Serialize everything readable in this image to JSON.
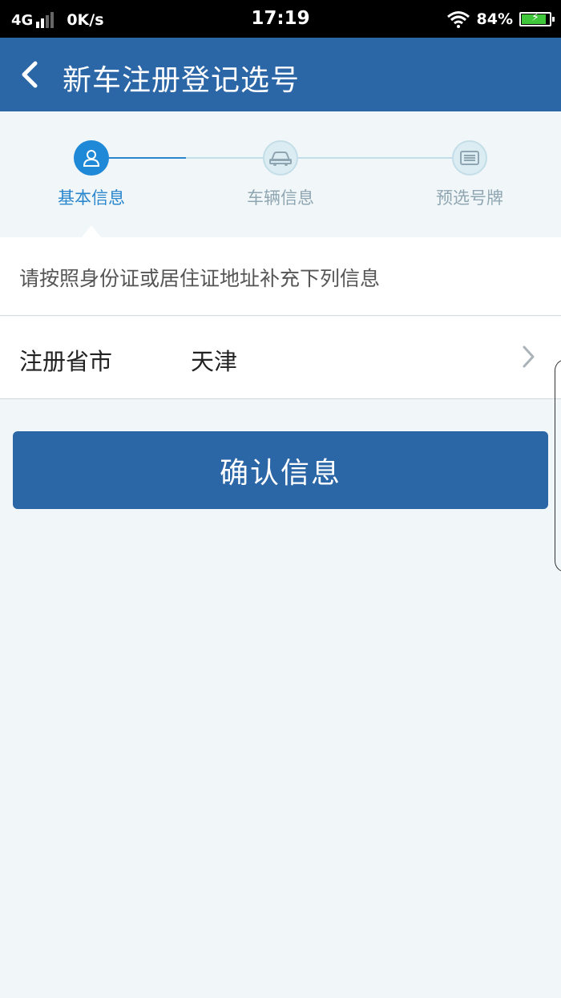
{
  "status_bar": {
    "network": "4G",
    "speed": "0K/s",
    "time": "17:19",
    "battery_text": "84%",
    "battery_level": 0.84,
    "battery_icon": "battery-charging-icon",
    "wifi_icon": "wifi-icon",
    "signal_icon": "signal-icon"
  },
  "header": {
    "title": "新车注册登记选号",
    "back_icon": "chevron-left-icon",
    "background": "#2b66a6"
  },
  "steps": [
    {
      "label": "基本信息",
      "icon": "user-icon",
      "state": "active"
    },
    {
      "label": "车辆信息",
      "icon": "car-icon",
      "state": "inactive"
    },
    {
      "label": "预选号牌",
      "icon": "license-plate-icon",
      "state": "inactive"
    }
  ],
  "form": {
    "hint": "请按照身份证或居住证地址补充下列信息",
    "province_label": "注册省市",
    "province_value": "天津",
    "chevron_icon": "chevron-right-icon"
  },
  "confirm_button": {
    "label": "确认信息"
  },
  "colors": {
    "accent": "#1f88d7",
    "primary": "#2b66a6",
    "background": "#f1f7f8",
    "inactive": "#8fa6b2"
  }
}
